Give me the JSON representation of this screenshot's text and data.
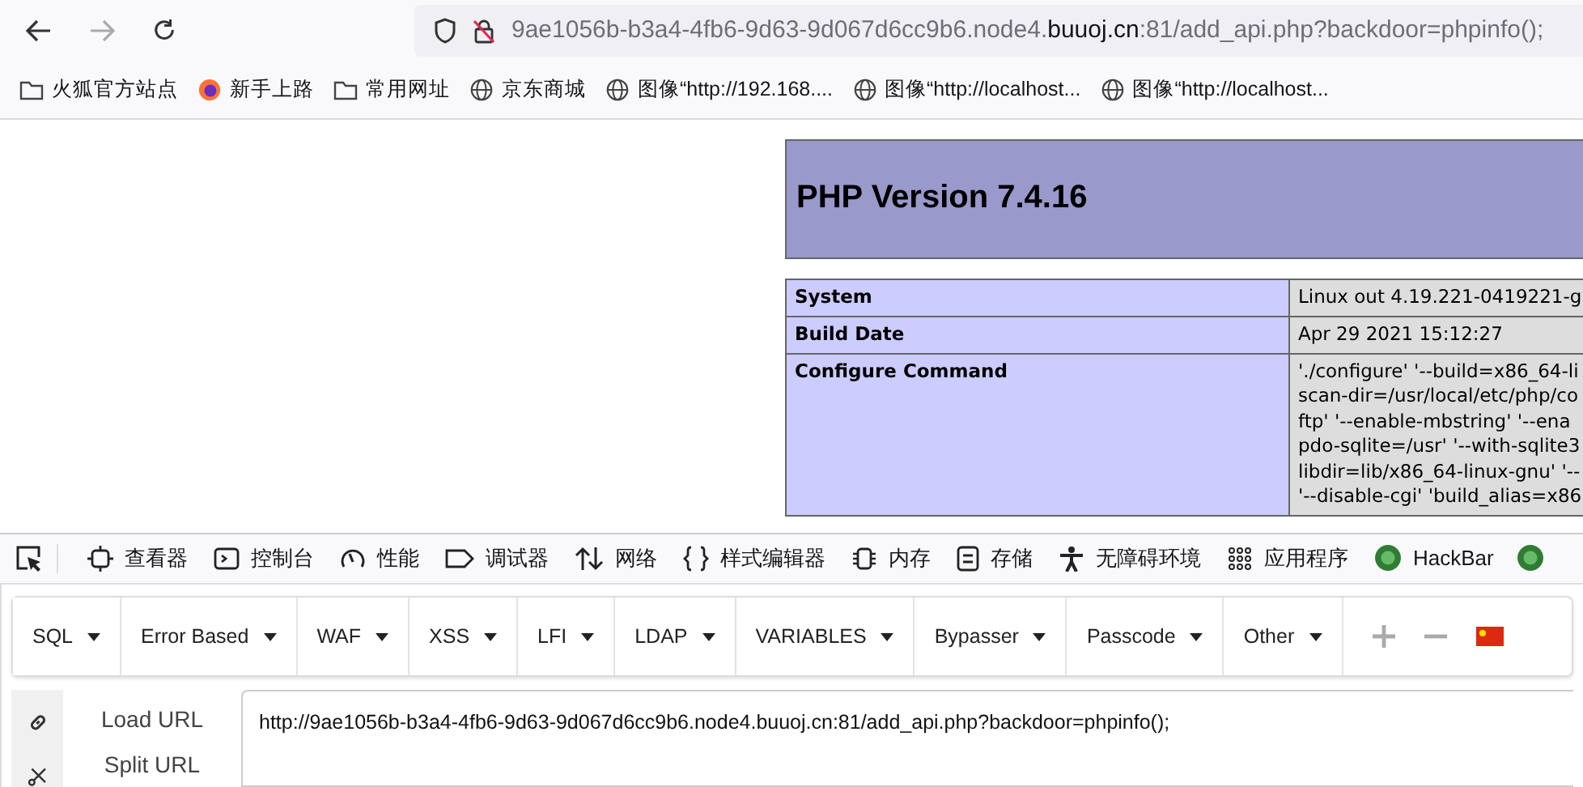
{
  "browser": {
    "url_host_prefix": "9ae1056b-b3a4-4fb6-9d63-9d067d6cc9b6.node4.",
    "url_domain": "buuoj.cn",
    "url_rest": ":81/add_api.php?backdoor=phpinfo();"
  },
  "bookmarks": [
    {
      "kind": "folder",
      "label": "火狐官方站点"
    },
    {
      "kind": "firefox",
      "label": "新手上路"
    },
    {
      "kind": "folder",
      "label": "常用网址"
    },
    {
      "kind": "globe",
      "label": "京东商城"
    },
    {
      "kind": "globe",
      "label": "图像“http://192.168...."
    },
    {
      "kind": "globe",
      "label": "图像“http://localhost..."
    },
    {
      "kind": "globe",
      "label": "图像“http://localhost..."
    }
  ],
  "phpinfo": {
    "title": "PHP Version 7.4.16",
    "rows": [
      {
        "label": "System",
        "value": [
          "Linux out 4.19.221-0419221-g"
        ]
      },
      {
        "label": "Build Date",
        "value": [
          "Apr 29 2021 15:12:27"
        ]
      },
      {
        "label": "Configure Command",
        "value": [
          "'./configure' '--build=x86_64-li",
          "scan-dir=/usr/local/etc/php/co",
          "ftp' '--enable-mbstring' '--ena",
          "pdo-sqlite=/usr' '--with-sqlite3",
          "libdir=lib/x86_64-linux-gnu' '--",
          "'--disable-cgi' 'build_alias=x86"
        ]
      }
    ]
  },
  "devtools_tabs": [
    {
      "kind": "inspector",
      "label": "查看器"
    },
    {
      "kind": "console",
      "label": "控制台"
    },
    {
      "kind": "performance",
      "label": "性能"
    },
    {
      "kind": "debugger",
      "label": "调试器"
    },
    {
      "kind": "network",
      "label": "网络"
    },
    {
      "kind": "style",
      "label": "样式编辑器"
    },
    {
      "kind": "memory",
      "label": "内存"
    },
    {
      "kind": "storage",
      "label": "存储"
    },
    {
      "kind": "accessibility",
      "label": "无障碍环境"
    },
    {
      "kind": "apps",
      "label": "应用程序"
    },
    {
      "kind": "hackbar",
      "label": "HackBar"
    }
  ],
  "hackbar": {
    "menus": [
      "SQL",
      "Error Based",
      "WAF",
      "XSS",
      "LFI",
      "LDAP",
      "VARIABLES",
      "Bypasser",
      "Passcode",
      "Other"
    ],
    "actions": [
      {
        "label": "Load URL"
      },
      {
        "label": "Split URL"
      }
    ],
    "url_value": "http://9ae1056b-b3a4-4fb6-9d63-9d067d6cc9b6.node4.buuoj.cn:81/add_api.php?backdoor=phpinfo();"
  }
}
